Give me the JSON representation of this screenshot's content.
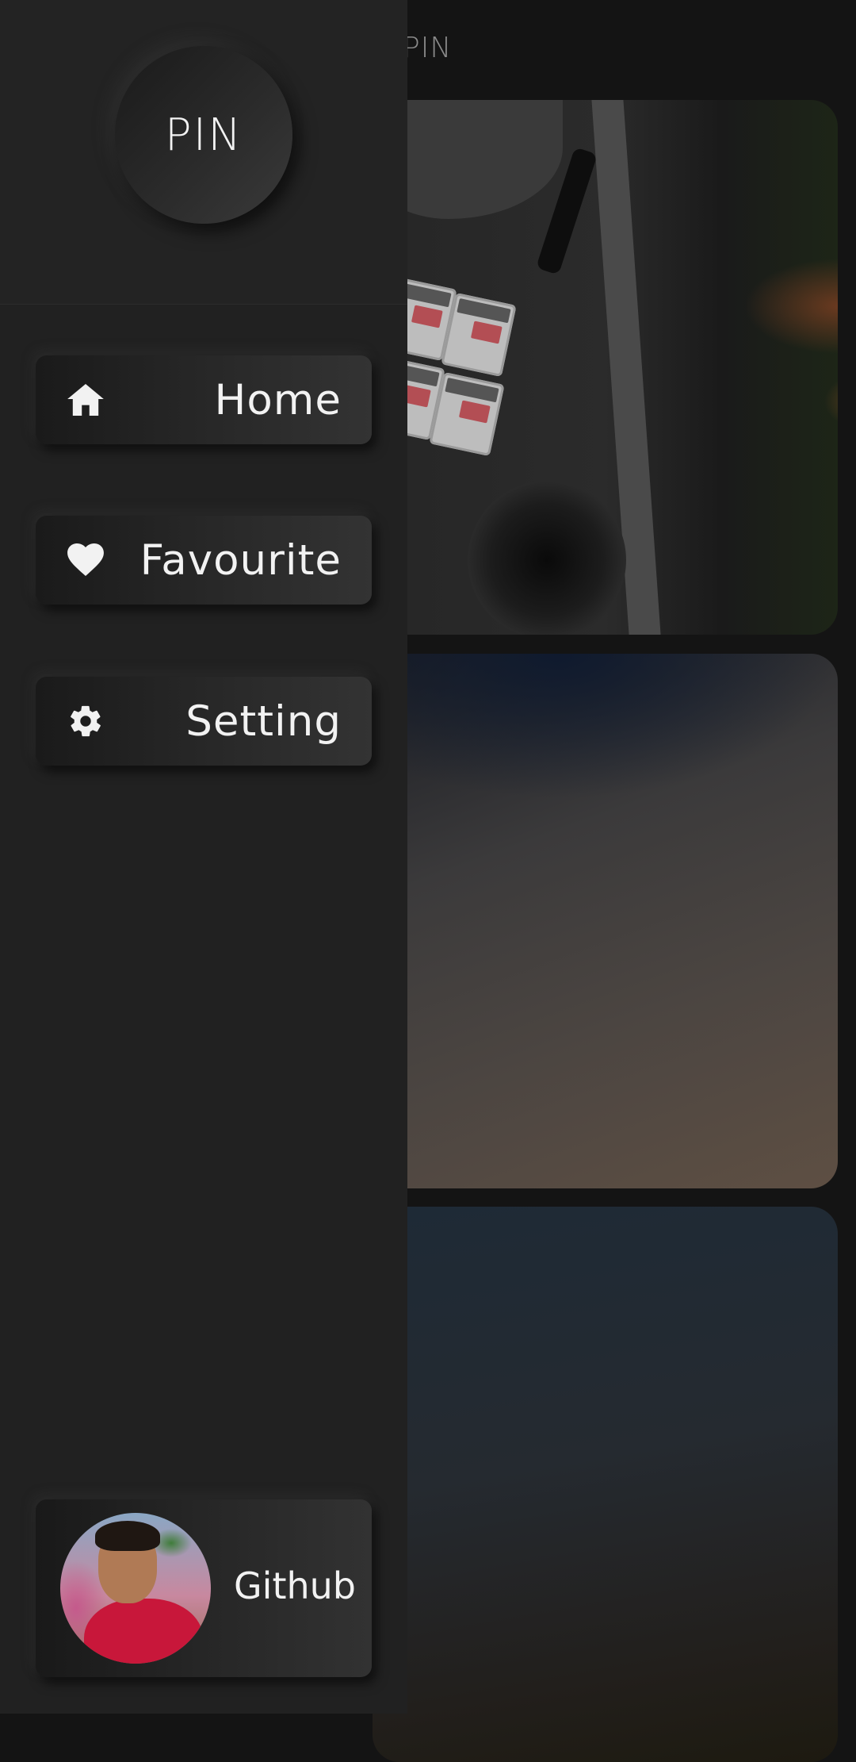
{
  "app": {
    "title": "PIN"
  },
  "drawer": {
    "logo_text": "PIN",
    "items": [
      {
        "label": "Home",
        "icon": "home-icon"
      },
      {
        "label": "Favourite",
        "icon": "heart-icon"
      },
      {
        "label": "Setting",
        "icon": "gear-icon"
      }
    ],
    "github": {
      "label": "Github",
      "avatar": "profile-photo"
    }
  },
  "colors": {
    "drawer_bg": "#212121",
    "page_bg": "#141414",
    "text": "#f2f2f2"
  }
}
